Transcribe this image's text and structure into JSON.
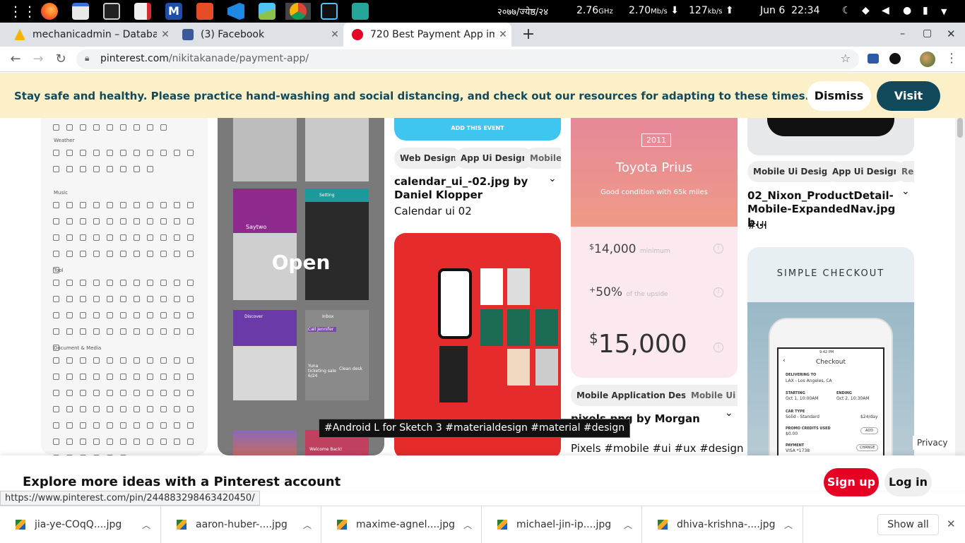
{
  "taskbar": {
    "date_np": "२०७७/ज्येष्ठ/२४",
    "cpu": "2.76",
    "cpu_unit": "GHz",
    "net_down": "2.70",
    "net_down_unit": "Mb/s",
    "net_up": "127",
    "net_up_unit": "kb/s",
    "clock": "Jun 6  22:34",
    "apps": [
      "apps-grid-icon",
      "firefox-icon",
      "files-icon",
      "terminal-icon",
      "editor-icon",
      "mailspring-icon",
      "git-icon",
      "vscode-icon",
      "image-viewer-icon",
      "chrome-icon",
      "mixer-icon",
      "stremio-icon"
    ]
  },
  "tabs": [
    {
      "title": "mechanicadmin – Databa",
      "close": "✕",
      "color": "#f4b400"
    },
    {
      "title": "(3) Facebook",
      "close": "✕",
      "color": "#3b5998"
    },
    {
      "title": "720 Best Payment App im",
      "close": "✕",
      "color": "#e60023"
    }
  ],
  "new_tab": "+",
  "window_controls": [
    "–",
    "▢",
    "✕"
  ],
  "address": {
    "host": "pinterest.com",
    "path": "/nikitakanade/payment-app/"
  },
  "banner": {
    "text": "Stay safe and healthy. Please practice hand-washing and social distancing, and check out our resources for adapting to these times.",
    "dismiss": "Dismiss",
    "visit": "Visit"
  },
  "col1": {
    "headings": [
      "Weather",
      "Music",
      "Tool",
      "Document & Media"
    ]
  },
  "col2": {
    "overlay": "Open",
    "screen_texts": [
      "Saytwo",
      "Setting",
      "Discover",
      "Inbox",
      "Call Jennifer",
      "Clean desk",
      "Yuna ticketing sale 6/24",
      "Welcome Back!"
    ]
  },
  "col3": {
    "event_button": "ADD THIS EVENT",
    "tags": [
      "Web Design",
      "App Ui Design",
      "Mobile /"
    ],
    "title": "calendar_ui_-02.jpg by Daniel Klopper",
    "subtitle": "Calendar ui 02",
    "tooltip": "#Android L for Sketch 3 #materialdesign #material #design"
  },
  "col4": {
    "year": "2011",
    "car": "Toyota Prius",
    "condition": "Good condition with 65k miles",
    "row1_amount": "14,000",
    "row1_label": "minimum",
    "row2_amount": "50%",
    "row2_label": "of the upside",
    "total": "15,000",
    "currency": "$",
    "plus": "+",
    "tags": [
      "Mobile Application Design",
      "Mobile Ui De"
    ],
    "title": "pixels.png by Morgan Allan",
    "subtitle": "Pixels #mobile #ui #ux #design"
  },
  "col5": {
    "tags": [
      "Mobile Ui Design",
      "App Ui Design",
      "Re"
    ],
    "title": "02_Nixon_ProductDetail-Mobile-ExpandedNav.jpg b...",
    "subtitle": "#UI",
    "checkout_heading": "SIMPLE CHECKOUT",
    "phone": {
      "time": "9:42 PM",
      "screen_title": "Checkout",
      "delivering_label": "DELIVERING TO",
      "delivering_value": "LAX - Los Angeles, CA",
      "starting_label": "STARTING",
      "starting_value": "Oct 1, 10:00AM",
      "ending_label": "ENDING",
      "ending_value": "Oct 2, 10:30AM",
      "car_label": "CAR TYPE",
      "car_value": "Solid - Standard",
      "car_price": "$24/day",
      "promo_label": "PROMO CREDITS USED",
      "promo_value": "$0.00",
      "promo_action": "ADD",
      "payment_label": "PAYMENT",
      "payment_value": "VISA *1738",
      "payment_action": "CHANGE"
    }
  },
  "privacy": "Privacy",
  "bottom": {
    "text": "Explore more ideas with a Pinterest account",
    "signup": "Sign up",
    "login": "Log in"
  },
  "status_url": "https://www.pinterest.com/pin/244883298463420450/",
  "downloads": [
    "jia-ye-COqQ....jpg",
    "aaron-huber-....jpg",
    "maxime-agnel....jpg",
    "michael-jin-ip....jpg",
    "dhiva-krishna-....jpg"
  ],
  "show_all": "Show all"
}
